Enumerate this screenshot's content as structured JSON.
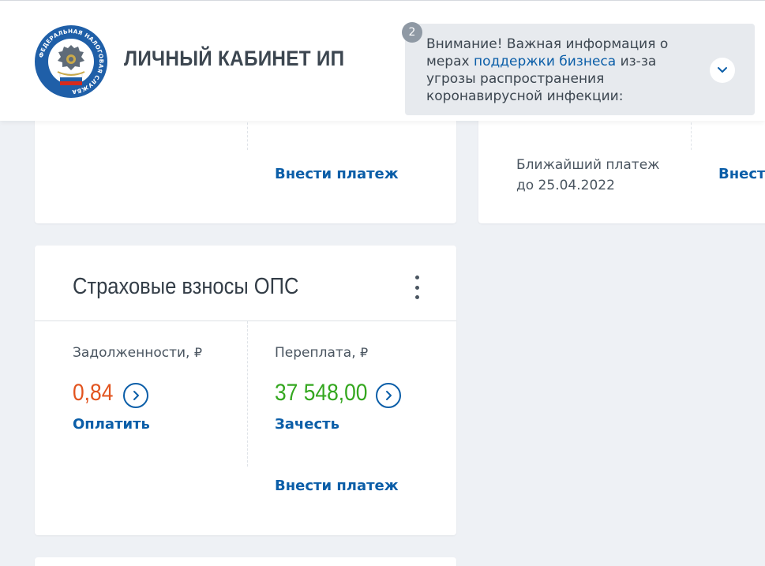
{
  "header": {
    "title": "ЛИЧНЫЙ КАБИНЕТ ИП",
    "logo_text": "ФЕДЕРАЛЬНАЯ НАЛОГОВАЯ СЛУЖБА",
    "notice": {
      "badge": "2",
      "text_before": "Внимание! Важная информация о мерах ",
      "link": "поддержки бизнеса",
      "text_after": " из-за угрозы распространения коронавирусной инфекции:"
    }
  },
  "card_a": {
    "pay_link": "Внести платеж"
  },
  "card_b": {
    "next_payment_label": "Ближайший платеж",
    "next_payment_date": "до 25.04.2022",
    "pay_link": "Внести"
  },
  "card_ops": {
    "title": "Страховые взносы ОПС",
    "debt_label": "Задолженности,",
    "debt_value": "0,84",
    "debt_action": "Оплатить",
    "overpay_label": "Переплата,",
    "overpay_value": "37 548,00",
    "overpay_action": "Зачесть",
    "pay_link": "Внести платеж",
    "currency_symbol": "₽"
  },
  "colors": {
    "accent": "#0b5ea8",
    "debt": "#e2541f",
    "overpay": "#34a71f",
    "background": "#eef1f5"
  }
}
